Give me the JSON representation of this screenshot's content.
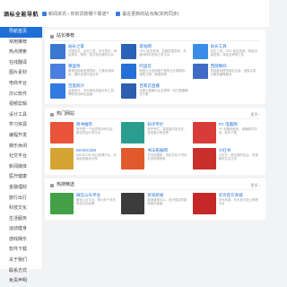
{
  "site": {
    "logo": "酒标全能导航"
  },
  "topbar": {
    "items": [
      {
        "text": "新闻资讯 › 你的贷款哪个靠谱?"
      },
      {
        "text": "最近更新的站点库(实时同步)"
      }
    ]
  },
  "sidebar": {
    "items": [
      {
        "label": "导航首页"
      },
      {
        "label": "常用推荐"
      },
      {
        "label": "热点搜索"
      },
      {
        "label": "在线翻译"
      },
      {
        "label": "图片素材"
      },
      {
        "label": "电商平台"
      },
      {
        "label": "办公软件"
      },
      {
        "label": "视频剪辑"
      },
      {
        "label": "设计工具"
      },
      {
        "label": "学习资源"
      },
      {
        "label": "编程开发"
      },
      {
        "label": "娱乐休闲"
      },
      {
        "label": "社交平台"
      },
      {
        "label": "新闻媒体"
      },
      {
        "label": "医疗健康"
      },
      {
        "label": "金融理财"
      },
      {
        "label": "旅行出行"
      },
      {
        "label": "科技文化"
      },
      {
        "label": "生活服务"
      },
      {
        "label": "运动健身"
      },
      {
        "label": "游戏娱乐"
      },
      {
        "label": "软件下载"
      },
      {
        "label": "关于我们"
      },
      {
        "label": "联系方式"
      },
      {
        "label": "免责声明"
      }
    ]
  },
  "sections": {
    "recommended": {
      "title": "站长推荐",
      "items": [
        {
          "name": "站长之家",
          "desc": "中国站长，站长工具，站长资讯，网站排名，提供一站式站长服务平台",
          "color": "#3a78d0",
          "icon": "chinaz-icon"
        },
        {
          "name": "爱站网",
          "desc": "SEO 综合查询，百度权重查询，关键词排名查询工具平台",
          "color": "#2a62b8",
          "icon": "aizhan-icon"
        },
        {
          "name": "站长工具",
          "desc": "站长工具，SEO 综合查询，网站流量查询，域名查询等工具",
          "color": "#3b8ee8",
          "icon": "tool-icon"
        },
        {
          "name": "哪里找",
          "desc": "哪里找网络资源导航，汇集实用网站，提供优质内容分享",
          "color": "#4a7fe0",
          "icon": "find-icon"
        },
        {
          "name": "阿里云",
          "desc": "阿里云为全球客户提供云计算服务，弹性计算、数据库等",
          "color": "#2570d6",
          "icon": "cloud-icon"
        },
        {
          "name": "西部数码",
          "desc": "西部数码提供域名注册、虚拟主机、云服务器等服务",
          "color": "#3e6cc4",
          "icon": "west-icon"
        },
        {
          "name": "百度统计",
          "desc": "百度统计，专业网站流量分析工具，帮助优化网站运营",
          "color": "#2f7be2",
          "icon": "stat-icon"
        },
        {
          "name": "百家云直播",
          "desc": "百家云直播为企业提供一站式直播解决方案",
          "color": "#2d5fb0",
          "icon": "live-icon"
        }
      ]
    },
    "hot": {
      "title": "热门网站",
      "more": "更多 ›",
      "items": [
        {
          "name": "简书推荐",
          "desc": "简书是一个优质的创作社区，原创内容分享平台",
          "color": "#e8533a",
          "icon": "jianshu-icon"
        },
        {
          "name": "知乎专栏",
          "desc": "知乎专栏，高质量问答社区，发现更大的世界",
          "color": "#2a9d8f",
          "icon": "zhihu-icon"
        },
        {
          "name": "PC 电脑网",
          "desc": "PC 电脑网资讯，电脑硬件评测，软件下载",
          "color": "#d93a3a",
          "icon": "pc-icon"
        },
        {
          "name": "MAGICOM",
          "desc": "MAGICOM 设计资源平台，灵感创意素材分享",
          "color": "#d6a335",
          "icon": "magic-icon"
        },
        {
          "name": "书法拓展网",
          "desc": "书法拓展网，传统文化与书法艺术资源收录",
          "color": "#e05a2b",
          "icon": "brush-icon"
        },
        {
          "name": "小红书",
          "desc": "小红书，标记我的生活，发现美好生活方式",
          "color": "#c9302c",
          "icon": "book-icon"
        }
      ]
    },
    "daily": {
      "title": "热搜精选",
      "more": "更多 ›",
      "items": [
        {
          "name": "微信公众平台",
          "desc": "微信公众平台，再小的个体也有自己的品牌",
          "color": "#43a047",
          "icon": "wechat-icon"
        },
        {
          "name": "新浪新闻",
          "desc": "新浪新闻中心，全天候实时新闻资讯报道",
          "color": "#3b3b3b",
          "icon": "news-icon"
        },
        {
          "name": "华为官方商城",
          "desc": "华为商城，华为官方线上购物平台",
          "color": "#c62828",
          "icon": "huawei-icon"
        }
      ]
    }
  }
}
